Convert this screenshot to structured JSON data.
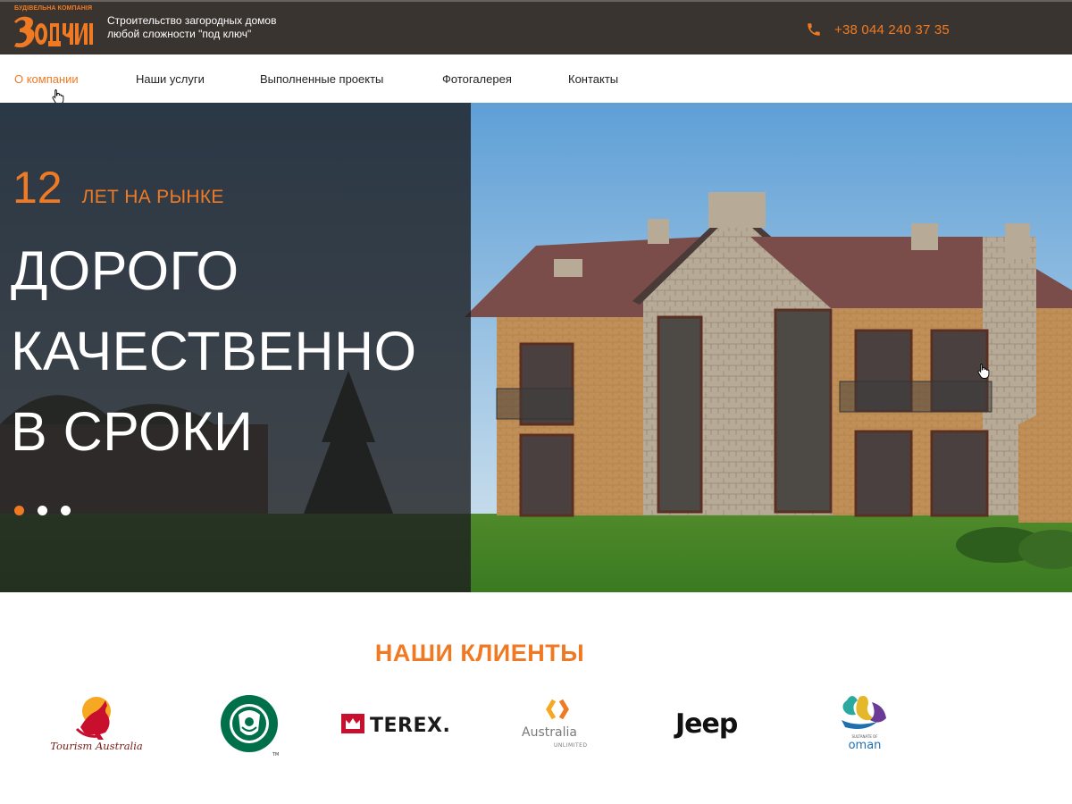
{
  "header": {
    "logo_caption": "БУДІВЕЛЬНА КОМПАНІЯ",
    "logo_name": "ЗОДЧИЕ",
    "tagline_line1": "Строительство загородных домов",
    "tagline_line2": "любой сложности \"под ключ\"",
    "phone": "+38 044 240 37 35",
    "phone_icon": "phone-icon"
  },
  "nav": {
    "items": [
      {
        "label": "О компании",
        "active": true
      },
      {
        "label": "Наши услуги",
        "active": false
      },
      {
        "label": "Выполненные проекты",
        "active": false
      },
      {
        "label": "Фотогалерея",
        "active": false
      },
      {
        "label": "Контакты",
        "active": false
      }
    ]
  },
  "hero": {
    "years_number": "12",
    "years_label": "ЛЕТ НА РЫНКЕ",
    "line1": "ДОРОГО",
    "line2": "КАЧЕСТВЕННО",
    "line3": "В СРОКИ",
    "slides_count": 3,
    "active_slide": 1
  },
  "clients": {
    "title": "НАШИ КЛИЕНТЫ",
    "logos": [
      {
        "name": "Tourism Australia",
        "text": "Tourism Australia"
      },
      {
        "name": "Starbucks",
        "text": "TM"
      },
      {
        "name": "Terex",
        "text": "TEREX."
      },
      {
        "name": "Australia Unlimited",
        "text": "Australia",
        "subtext": "UNLIMITED"
      },
      {
        "name": "Jeep",
        "text": "Jeep"
      },
      {
        "name": "Oman",
        "text": "oman",
        "subtext": "SULTANATE OF"
      }
    ]
  },
  "colors": {
    "accent": "#f07a23",
    "topbar": "#3a3430",
    "overlay": "#1e1e20"
  }
}
